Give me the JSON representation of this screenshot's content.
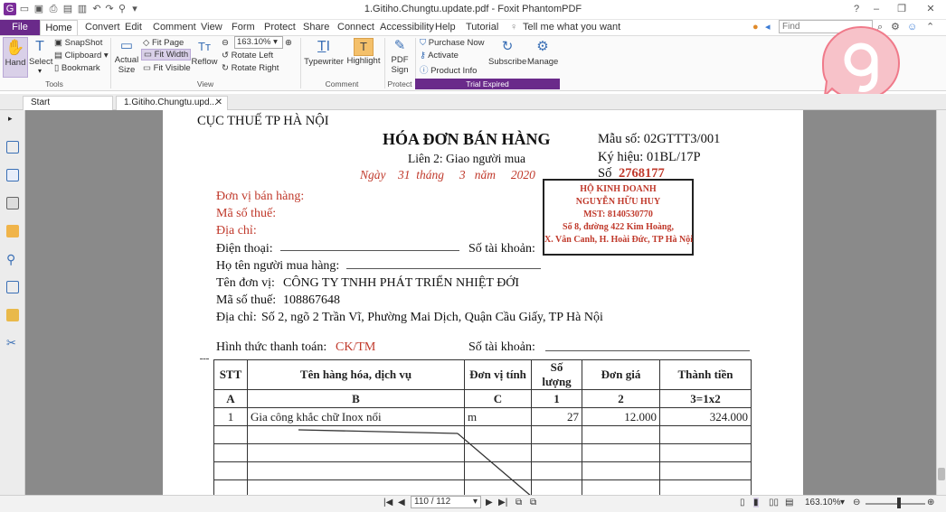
{
  "window": {
    "title": "1.Gitiho.Chungtu.update.pdf - Foxit PhantomPDF"
  },
  "search": {
    "placeholder": "Find"
  },
  "menu": {
    "file": "File",
    "items": [
      "Home",
      "Convert",
      "Edit",
      "Comment",
      "View",
      "Form",
      "Protect",
      "Share",
      "Connect",
      "Accessibility",
      "Help",
      "Tutorial"
    ],
    "tell_me": "Tell me what you want"
  },
  "ribbon": {
    "hand": "Hand",
    "select": "Select",
    "snapshot": "SnapShot",
    "clipboard": "Clipboard",
    "bookmark": "Bookmark",
    "actual_size_1": "Actual",
    "actual_size_2": "Size",
    "fit_page": "Fit Page",
    "fit_width": "Fit Width",
    "fit_visible": "Fit Visible",
    "reflow": "Reflow",
    "zoom": "163.10%",
    "rotate_left": "Rotate Left",
    "rotate_right": "Rotate Right",
    "typewriter": "Typewriter",
    "highlight": "Highlight",
    "pdf_sign_1": "PDF",
    "pdf_sign_2": "Sign",
    "purchase_now": "Purchase Now",
    "activate": "Activate",
    "product_info": "Product Info",
    "subscribe": "Subscribe",
    "manage": "Manage",
    "groups": {
      "tools": "Tools",
      "view": "View",
      "comment": "Comment",
      "protect": "Protect",
      "trial": "Trial Expired"
    }
  },
  "tabs": {
    "start": "Start",
    "doc": "1.Gitiho.Chungtu.upd..."
  },
  "invoice": {
    "agency": "CỤC THUẾ TP HÀ NỘI",
    "title": "HÓA ĐƠN BÁN HÀNG",
    "copy": "Liên 2: Giao người mua",
    "date": "Ngày    31  tháng     3   năm     2020",
    "form_no": "Mẫu số: 02GTTT3/001",
    "symbol": "Ký hiệu:  01BL/17P",
    "number_label": "Số",
    "number": "2768177",
    "seller_unit": "Đơn vị bán hàng:",
    "seller_tax": "Mã số thuế:",
    "seller_addr": "Địa chỉ:",
    "phone": "Điện thoại:",
    "account": "Số tài khoản:",
    "buyer_name": "Họ tên người mua hàng:",
    "buyer_unit_label": "Tên đơn vị:",
    "buyer_unit": "CÔNG TY TNHH PHÁT TRIỂN NHIỆT ĐỚI",
    "buyer_tax_label": "Mã số thuế:",
    "buyer_tax": "108867648",
    "buyer_addr_label": "Địa chỉ:",
    "buyer_addr": "Số 2, ngõ 2 Trần Vĩ, Phường Mai Dịch, Quận Cầu Giấy, TP Hà Nội",
    "payment_label": "Hình thức thanh toán:",
    "payment": "CK/TM",
    "account2": "Số tài khoản:"
  },
  "stamp": {
    "l1": "HỘ KINH DOANH",
    "l2": "NGUYỄN HỮU HUY",
    "l3": "MST: 8140530770",
    "l4": "Số 8, đường 422 Kim Hoàng,",
    "l5": "X. Vân Canh, H. Hoài Đức, TP Hà Nội"
  },
  "table": {
    "headers": [
      "STT",
      "Tên hàng hóa, dịch vụ",
      "Đơn vị tính",
      "Số lượng",
      "Đơn giá",
      "Thành tiền"
    ],
    "codes": [
      "A",
      "B",
      "C",
      "1",
      "2",
      "3=1x2"
    ],
    "row1": [
      "1",
      "Gia công khắc chữ Inox nổi",
      "m",
      "27",
      "12.000",
      "324.000"
    ]
  },
  "status": {
    "page": "110 / 112",
    "zoom": "163.10%"
  },
  "colors": {
    "brand": "#6a2a8a",
    "stamp_red": "#c0392b",
    "logo_pink": "#f07a8a"
  }
}
